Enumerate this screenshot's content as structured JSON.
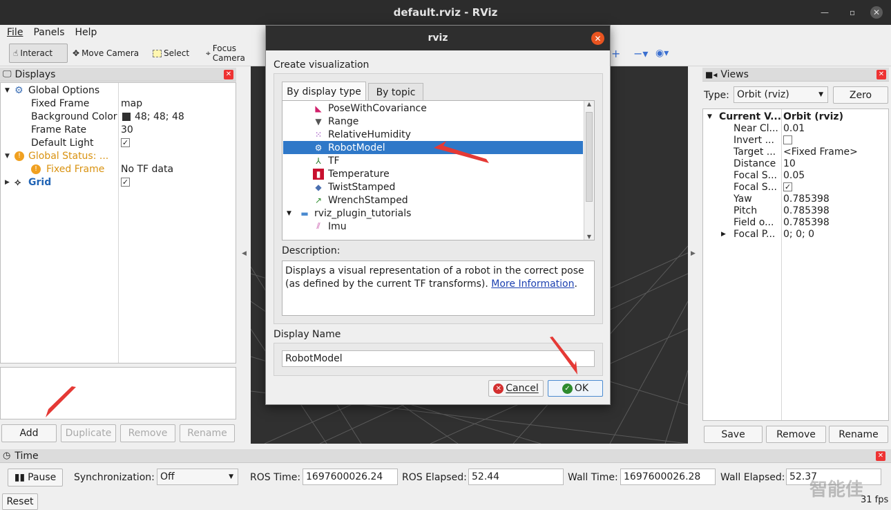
{
  "window": {
    "title": "default.rviz - RViz"
  },
  "menu": {
    "file": "File",
    "panels": "Panels",
    "help": "Help"
  },
  "toolbar": {
    "interact": "Interact",
    "move_camera": "Move Camera",
    "select": "Select",
    "focus_camera": "Focus Camera"
  },
  "displays": {
    "title": "Displays",
    "global_options": "Global Options",
    "fixed_frame_label": "Fixed Frame",
    "fixed_frame_value": "map",
    "background_color_label": "Background Color",
    "background_color_value": "48; 48; 48",
    "frame_rate_label": "Frame Rate",
    "frame_rate_value": "30",
    "default_light_label": "Default Light",
    "global_status": "Global Status: ...",
    "status_fixed_frame": "Fixed Frame",
    "status_fixed_frame_value": "No TF data",
    "grid": "Grid",
    "buttons": {
      "add": "Add",
      "duplicate": "Duplicate",
      "remove": "Remove",
      "rename": "Rename"
    }
  },
  "dialog": {
    "title": "rviz",
    "heading": "Create visualization",
    "tabs": {
      "by_display_type": "By display type",
      "by_topic": "By topic"
    },
    "items": [
      {
        "label": "PoseWithCovariance",
        "icon": "pose-icon"
      },
      {
        "label": "Range",
        "icon": "range-icon"
      },
      {
        "label": "RelativeHumidity",
        "icon": "humidity-icon"
      },
      {
        "label": "RobotModel",
        "icon": "robot-icon"
      },
      {
        "label": "TF",
        "icon": "axes-icon"
      },
      {
        "label": "Temperature",
        "icon": "thermometer-icon"
      },
      {
        "label": "TwistStamped",
        "icon": "twist-icon"
      },
      {
        "label": "WrenchStamped",
        "icon": "wrench-icon"
      },
      {
        "label": "rviz_plugin_tutorials",
        "icon": "folder-icon"
      },
      {
        "label": "Imu",
        "icon": "imu-icon"
      }
    ],
    "description_label": "Description:",
    "description_text": "Displays a visual representation of a robot in the correct pose (as defined by the current TF transforms).",
    "description_link": "More Information",
    "description_end": ".",
    "display_name_label": "Display Name",
    "display_name_value": "RobotModel",
    "cancel": "Cancel",
    "ok": "OK"
  },
  "views": {
    "title": "Views",
    "type_label": "Type:",
    "type_value": "Orbit (rviz)",
    "zero": "Zero",
    "current_view": "Current V...",
    "current_view_value": "Orbit (rviz)",
    "props": [
      {
        "label": "Near Cl...",
        "value": "0.01"
      },
      {
        "label": "Invert ...",
        "value": ""
      },
      {
        "label": "Target ...",
        "value": "<Fixed Frame>"
      },
      {
        "label": "Distance",
        "value": "10"
      },
      {
        "label": "Focal S...",
        "value": "0.05"
      },
      {
        "label": "Focal S...",
        "value": ""
      },
      {
        "label": "Yaw",
        "value": "0.785398"
      },
      {
        "label": "Pitch",
        "value": "0.785398"
      },
      {
        "label": "Field o...",
        "value": "0.785398"
      },
      {
        "label": "Focal P...",
        "value": "0; 0; 0"
      }
    ],
    "buttons": {
      "save": "Save",
      "remove": "Remove",
      "rename": "Rename"
    }
  },
  "time": {
    "title": "Time",
    "pause": "Pause",
    "sync_label": "Synchronization:",
    "sync_value": "Off",
    "ros_time_label": "ROS Time:",
    "ros_time_value": "1697600026.24",
    "ros_elapsed_label": "ROS Elapsed:",
    "ros_elapsed_value": "52.44",
    "wall_time_label": "Wall Time:",
    "wall_time_value": "1697600026.28",
    "wall_elapsed_label": "Wall Elapsed:",
    "wall_elapsed_value": "52.37",
    "reset": "Reset",
    "fps": "31 fps"
  },
  "watermark": "智能佳",
  "colors": {
    "accent": "#2f78c8",
    "warning": "#e8a317",
    "dialog_close": "#e95420",
    "arrow": "#e53935"
  }
}
